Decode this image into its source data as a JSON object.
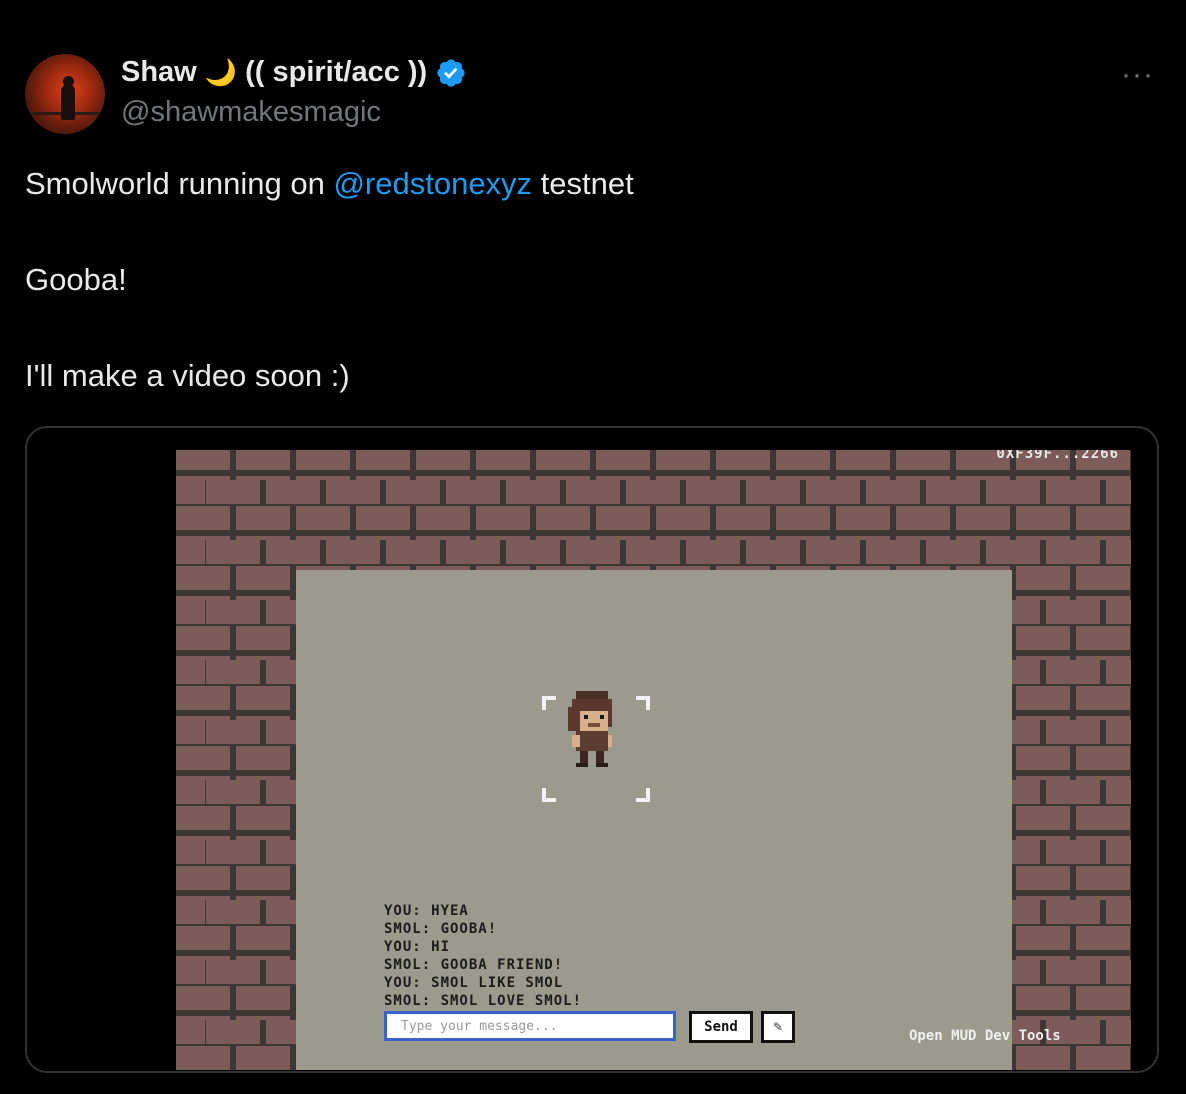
{
  "author": {
    "display_name": "Shaw",
    "moon_emoji": "🌙",
    "name_suffix": "(( spirit/acc ))",
    "handle": "@shawmakesmagic",
    "verified": true,
    "accent_color": "#1d9bf0"
  },
  "more_label": "···",
  "tweet": {
    "line1_prefix": "Smolworld running on ",
    "line1_mention": "@redstonexyz",
    "line1_suffix": " testnet",
    "line2": "Gooba!",
    "line3": "I'll make a video soon :)"
  },
  "game": {
    "wallet_address": "0XF39F...2266",
    "chat_log": [
      "YOU: HYEA",
      "SMOL: GOOBA!",
      "YOU: HI",
      "SMOL: GOOBA FRIEND!",
      "YOU: SMOL LIKE SMOL",
      "SMOL: SMOL LOVE SMOL!"
    ],
    "message_placeholder": "Type your message...",
    "send_label": "Send",
    "mic_icon": "✎",
    "devtools_label": "Open MUD Dev Tools"
  }
}
